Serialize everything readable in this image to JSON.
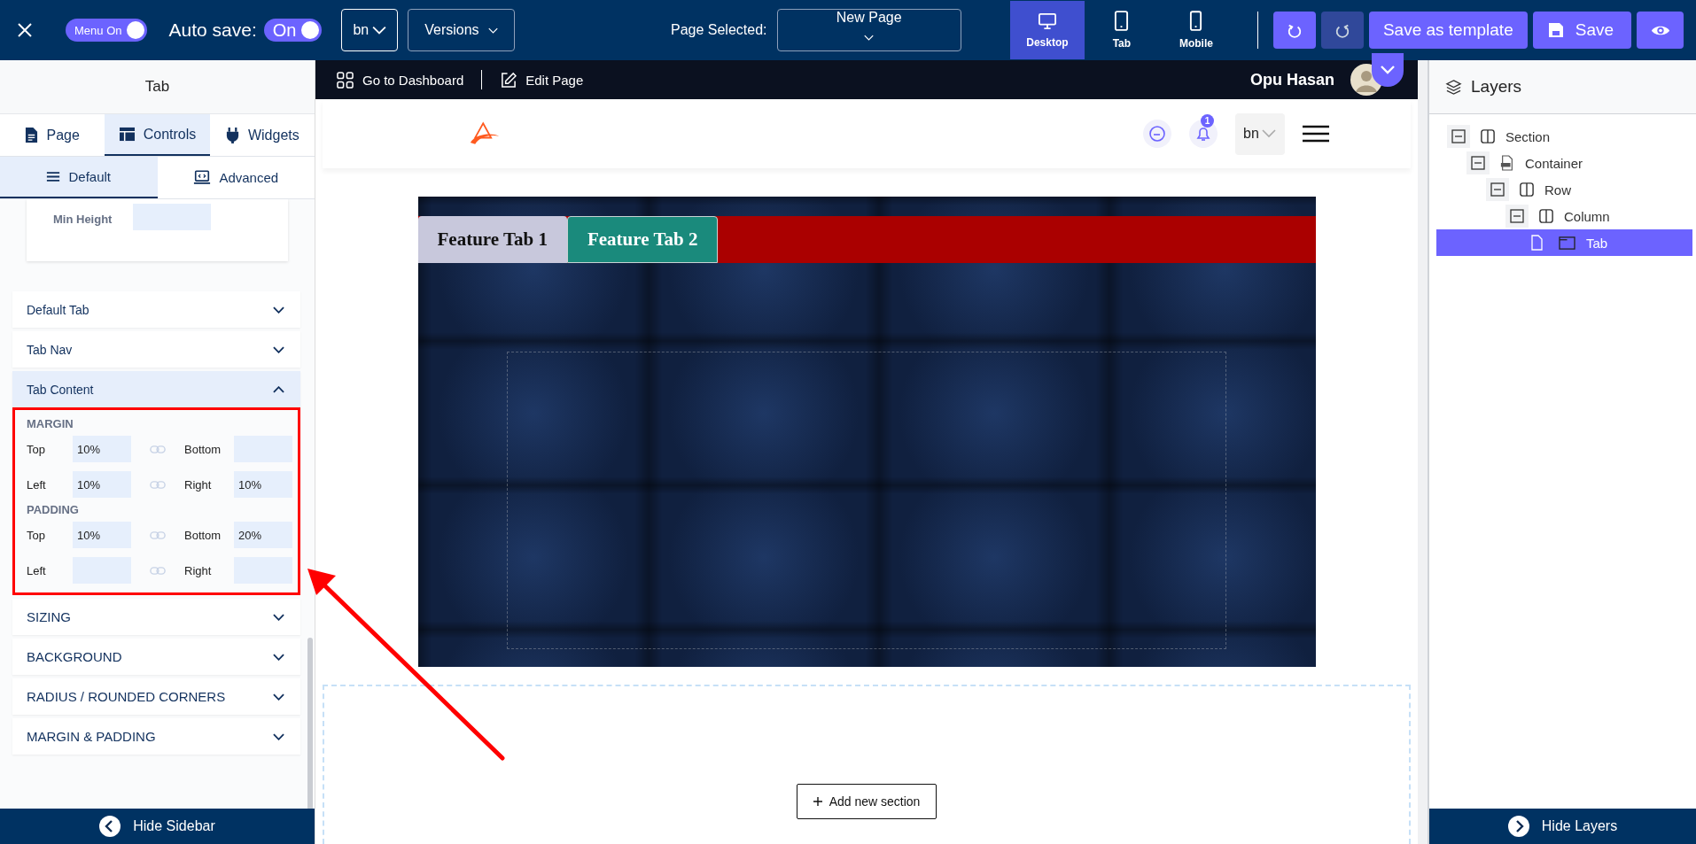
{
  "toolbar": {
    "menu_toggle": {
      "label": "Menu On",
      "on": true
    },
    "autosave": {
      "label": "Auto save:",
      "value": "On",
      "on": true
    },
    "language": "bn",
    "versions": "Versions",
    "page_selected": {
      "label": "Page Selected:",
      "value": "New Page"
    },
    "devices": [
      {
        "label": "Desktop",
        "kind": "desktop",
        "selected": true
      },
      {
        "label": "Tab",
        "kind": "tablet",
        "selected": false
      },
      {
        "label": "Mobile",
        "kind": "mobile",
        "selected": false
      }
    ],
    "undo": {
      "disabled": false
    },
    "redo": {
      "disabled": true
    },
    "save_template": "Save as template",
    "save": "Save"
  },
  "sidebar": {
    "title": "Tab",
    "tabs": [
      {
        "label": "Page",
        "kind": "page",
        "selected": false
      },
      {
        "label": "Controls",
        "kind": "controls",
        "selected": true
      },
      {
        "label": "Widgets",
        "kind": "widgets",
        "selected": false
      }
    ],
    "subtabs": [
      {
        "label": "Default",
        "kind": "default",
        "selected": true
      },
      {
        "label": "Advanced",
        "kind": "advanced",
        "selected": false
      }
    ],
    "min_height": {
      "label": "Min Height"
    },
    "accordions": [
      {
        "label": "Default Tab",
        "expanded": false
      },
      {
        "label": "Tab Nav",
        "expanded": false
      },
      {
        "label": "Tab Content",
        "expanded": true
      }
    ],
    "tab_content": {
      "groups": [
        {
          "title": "MARGIN",
          "fields": [
            {
              "label": "Top",
              "value": "10%"
            },
            {
              "label": "Bottom"
            },
            {
              "label": "Left",
              "value": "10%"
            },
            {
              "label": "Right",
              "value": "10%"
            }
          ]
        },
        {
          "title": "PADDING",
          "fields": [
            {
              "label": "Top",
              "value": "10%"
            },
            {
              "label": "Bottom",
              "value": "20%"
            },
            {
              "label": "Left"
            },
            {
              "label": "Right"
            }
          ]
        }
      ]
    },
    "sections": [
      {
        "label": "SIZING",
        "expanded": false
      },
      {
        "label": "BACKGROUND",
        "expanded": false
      },
      {
        "label": "RADIUS / ROUNDED CORNERS",
        "expanded": false
      },
      {
        "label": "MARGIN & PADDING",
        "expanded": false
      }
    ],
    "hide": "Hide Sidebar"
  },
  "canvas": {
    "topbar": {
      "dashboard": "Go to Dashboard",
      "edit": "Edit Page",
      "user": "Opu Hasan"
    },
    "site_header": {
      "badge": "1",
      "language": "bn"
    },
    "tabs": [
      {
        "label": "Feature Tab 1",
        "selected": false
      },
      {
        "label": "Feature Tab 2",
        "selected": true
      }
    ],
    "add_section": "Add new section"
  },
  "layers": {
    "title": "Layers",
    "tree": [
      {
        "label": "Section",
        "selected": false,
        "expanded": true,
        "children": [
          {
            "label": "Container",
            "kind": "container",
            "selected": false,
            "expanded": true,
            "children": [
              {
                "label": "Row",
                "selected": false,
                "expanded": true,
                "children": [
                  {
                    "label": "Column",
                    "selected": false,
                    "expanded": true,
                    "children": [
                      {
                        "label": "Tab",
                        "kind": "tab",
                        "selected": true
                      }
                    ]
                  }
                ]
              }
            ]
          }
        ]
      }
    ],
    "hide": "Hide Layers"
  }
}
